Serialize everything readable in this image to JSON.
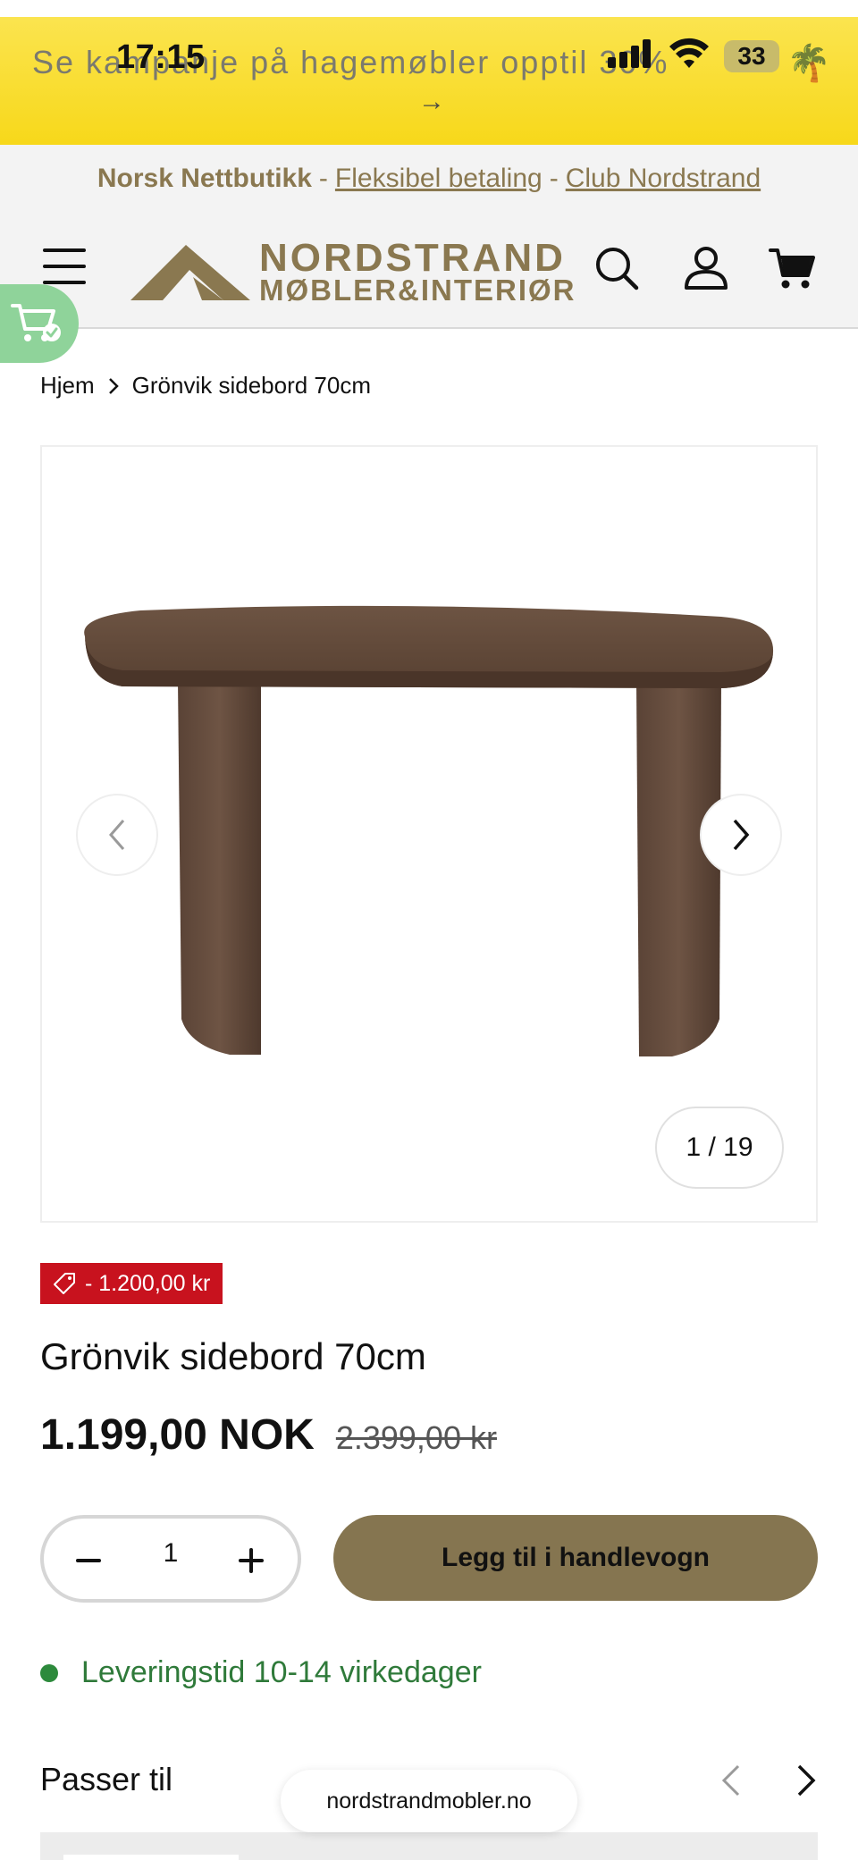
{
  "status_bar": {
    "time": "17:15",
    "battery": "33"
  },
  "promo": {
    "text": "Se kampanje på hagemøbler opptil 30%",
    "emoji": "🌴",
    "arrow": "→"
  },
  "info_bar": {
    "bold": "Norsk Nettbutikk",
    "separator": "-",
    "link1": "Fleksibel betaling",
    "link2": "Club Nordstrand"
  },
  "header": {
    "logo_line1": "NORDSTRAND",
    "logo_line2": "MØBLER&INTERIØR",
    "icons": [
      "menu-icon",
      "search-icon",
      "account-icon",
      "cart-icon"
    ],
    "brand_color": "#8a7850"
  },
  "breadcrumb": {
    "home": "Hjem",
    "separator": ">",
    "current": "Grönvik sidebord 70cm"
  },
  "gallery": {
    "counter": "1 / 19",
    "prev_icon": "chevron-left-icon",
    "next_icon": "chevron-right-icon"
  },
  "product": {
    "discount": "- 1.200,00 kr",
    "title": "Grönvik sidebord 70cm",
    "price": "1.199,00 NOK",
    "old_price": "2.399,00 kr",
    "quantity": "1",
    "add_to_cart": "Legg til i handlevogn",
    "delivery": "Leveringstid 10-14 virkedager"
  },
  "related": {
    "title": "Passer til"
  },
  "browser": {
    "url": "nordstrandmobler.no"
  },
  "colors": {
    "promo_yellow": "#f7d81a",
    "accent": "#857550",
    "sale_red": "#c8121e",
    "delivery_green": "#2d8a3c"
  }
}
